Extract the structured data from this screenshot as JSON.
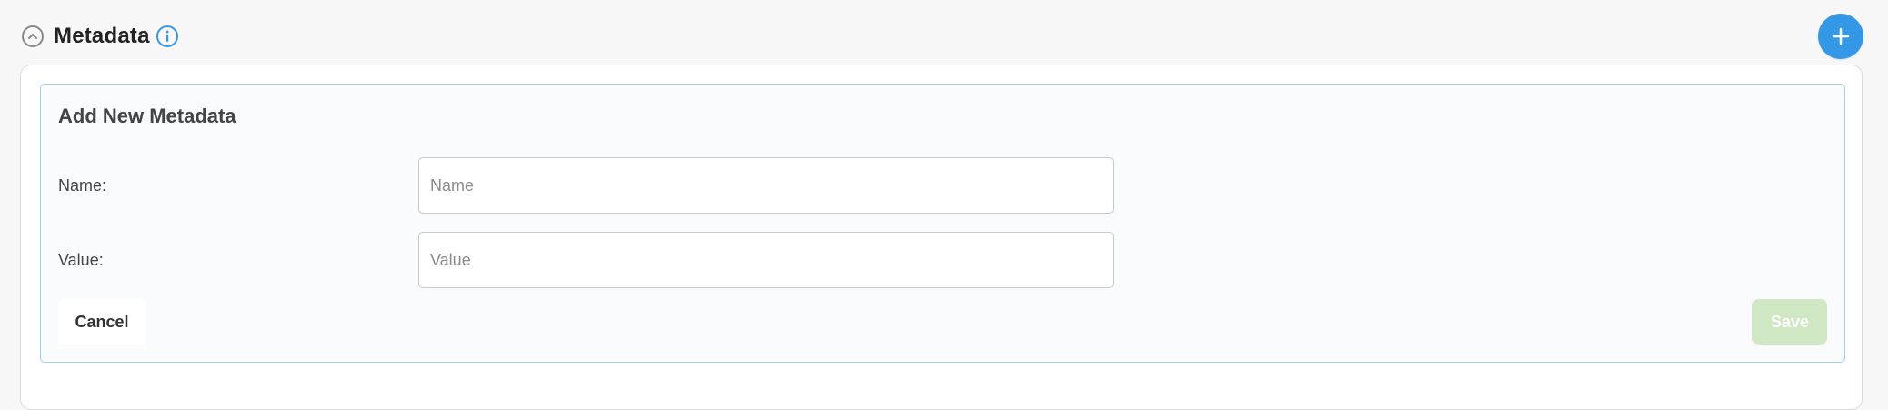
{
  "header": {
    "title": "Metadata",
    "collapse_icon": "chevron-up-icon",
    "info_icon": "info-icon",
    "add_icon": "plus-icon",
    "accent_color": "#3399e6"
  },
  "form": {
    "title": "Add New Metadata",
    "name_label": "Name:",
    "name_value": "",
    "name_placeholder": "Name",
    "value_label": "Value:",
    "value_value": "",
    "value_placeholder": "Value",
    "cancel_label": "Cancel",
    "save_label": "Save",
    "save_color": "#cfe7c3"
  }
}
